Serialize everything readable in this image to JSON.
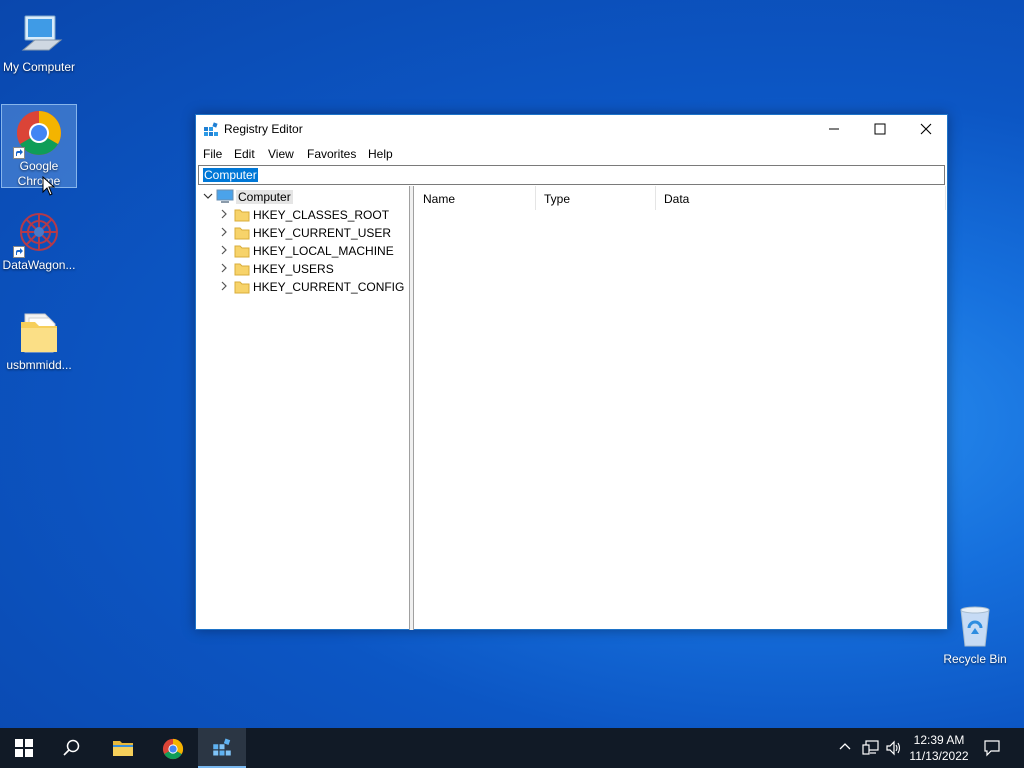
{
  "desktop": {
    "icons": [
      {
        "label": "My Computer"
      },
      {
        "label": "Google Chrome"
      },
      {
        "label": "DataWagon..."
      },
      {
        "label": "usbmmidd..."
      },
      {
        "label": "Recycle Bin"
      }
    ]
  },
  "window": {
    "title": "Registry Editor",
    "menu": [
      "File",
      "Edit",
      "View",
      "Favorites",
      "Help"
    ],
    "address": "Computer",
    "tree": {
      "root": "Computer",
      "children": [
        "HKEY_CLASSES_ROOT",
        "HKEY_CURRENT_USER",
        "HKEY_LOCAL_MACHINE",
        "HKEY_USERS",
        "HKEY_CURRENT_CONFIG"
      ]
    },
    "columns": [
      "Name",
      "Type",
      "Data"
    ]
  },
  "taskbar": {
    "time": "12:39 AM",
    "date": "11/13/2022",
    "pinned": [
      "windows-start-icon",
      "search-icon",
      "file-explorer-icon",
      "chrome-icon",
      "registry-editor-icon"
    ]
  },
  "colors": {
    "accent": "#0078d7",
    "taskbar": "#111a26",
    "desktop": "#0c56c4"
  }
}
